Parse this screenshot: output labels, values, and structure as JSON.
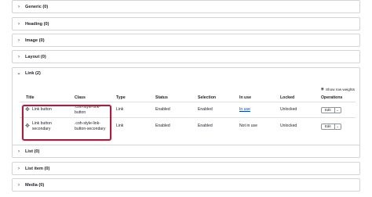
{
  "panels_top": [
    {
      "label": "Generic (0)"
    },
    {
      "label": "Heading (0)"
    },
    {
      "label": "Image (0)"
    },
    {
      "label": "Layout (0)"
    }
  ],
  "link_panel": {
    "label": "Link (2)",
    "show_weights": "Show row weights",
    "columns": [
      "Title",
      "Class",
      "Type",
      "Status",
      "Selection",
      "In use",
      "Locked",
      "Operations"
    ],
    "rows": [
      {
        "title": "Link button",
        "class": ".coh-style-link-button",
        "type": "Link",
        "status": "Enabled",
        "selection": "Enabled",
        "in_use": "In use",
        "locked": "Unlocked",
        "edit": "Edit"
      },
      {
        "title": "Link button secondary",
        "class": ".coh-style-link-button-secondary",
        "type": "Link",
        "status": "Enabled",
        "selection": "Enabled",
        "in_use": "Not in use",
        "locked": "Unlocked",
        "edit": "Edit"
      }
    ]
  },
  "panels_bottom": [
    {
      "label": "List (0)"
    },
    {
      "label": "List item (0)"
    },
    {
      "label": "Media (0)"
    }
  ],
  "icons": {
    "collapsed": "chevron-right-icon",
    "expanded": "chevron-down-icon",
    "drag": "drag-handle-icon",
    "eye": "eye-icon"
  },
  "colors": {
    "highlight": "#a31f3f",
    "link": "#003ecc",
    "border": "#d4d4d8"
  }
}
